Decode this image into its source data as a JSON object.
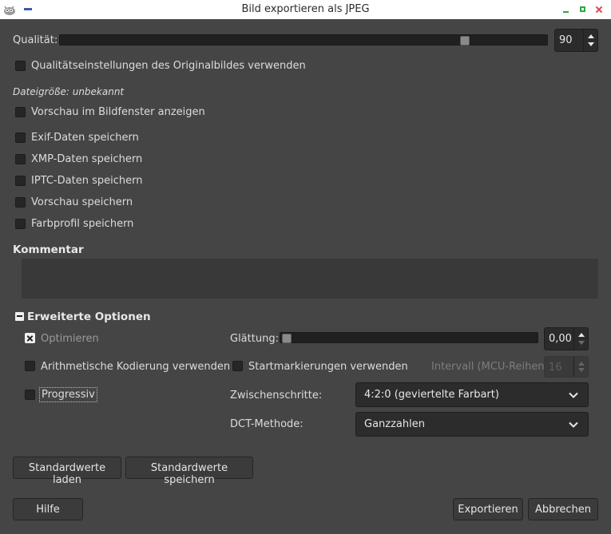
{
  "window": {
    "title": "Bild exportieren als JPEG"
  },
  "quality": {
    "label": "Qualität:",
    "value": "90",
    "fraction": 0.9
  },
  "use_original_quality": {
    "label": "Qualitätseinstellungen des Originalbildes verwenden",
    "checked": false
  },
  "filesize": {
    "label": "Dateigröße: unbekannt"
  },
  "preview_in_window": {
    "label": "Vorschau im Bildfenster anzeigen",
    "checked": false
  },
  "metadata": [
    {
      "label": "Exif-Daten speichern",
      "checked": false
    },
    {
      "label": "XMP-Daten speichern",
      "checked": false
    },
    {
      "label": "IPTC-Daten speichern",
      "checked": false
    },
    {
      "label": "Vorschau speichern",
      "checked": false
    },
    {
      "label": "Farbprofil speichern",
      "checked": false
    }
  ],
  "comment": {
    "heading": "Kommentar",
    "value": ""
  },
  "advanced": {
    "heading": "Erweiterte Optionen",
    "optimize": {
      "label": "Optimieren",
      "checked": true
    },
    "arithmetic": {
      "label": "Arithmetische Kodierung verwenden",
      "checked": false
    },
    "progressive": {
      "label": "Progressiv",
      "checked": false
    },
    "smoothing": {
      "label": "Glättung:",
      "value": "0,00",
      "fraction": 0.0
    },
    "restart_markers": {
      "label": "Startmarkierungen verwenden",
      "checked": false
    },
    "interval": {
      "label": "Intervall (MCU-Reihen):",
      "value": "16"
    },
    "subsampling": {
      "label": "Zwischenschritte:",
      "value": "4:2:0 (geviertelte Farbart)"
    },
    "dct": {
      "label": "DCT-Methode:",
      "value": "Ganzzahlen"
    }
  },
  "buttons": {
    "load_defaults": "Standardwerte laden",
    "save_defaults": "Standardwerte speichern",
    "help": "Hilfe",
    "export": "Exportieren",
    "cancel": "Abbrechen"
  },
  "colors": {
    "background": "#454545",
    "titlebar": "#ffffff",
    "trough": "#202020"
  }
}
